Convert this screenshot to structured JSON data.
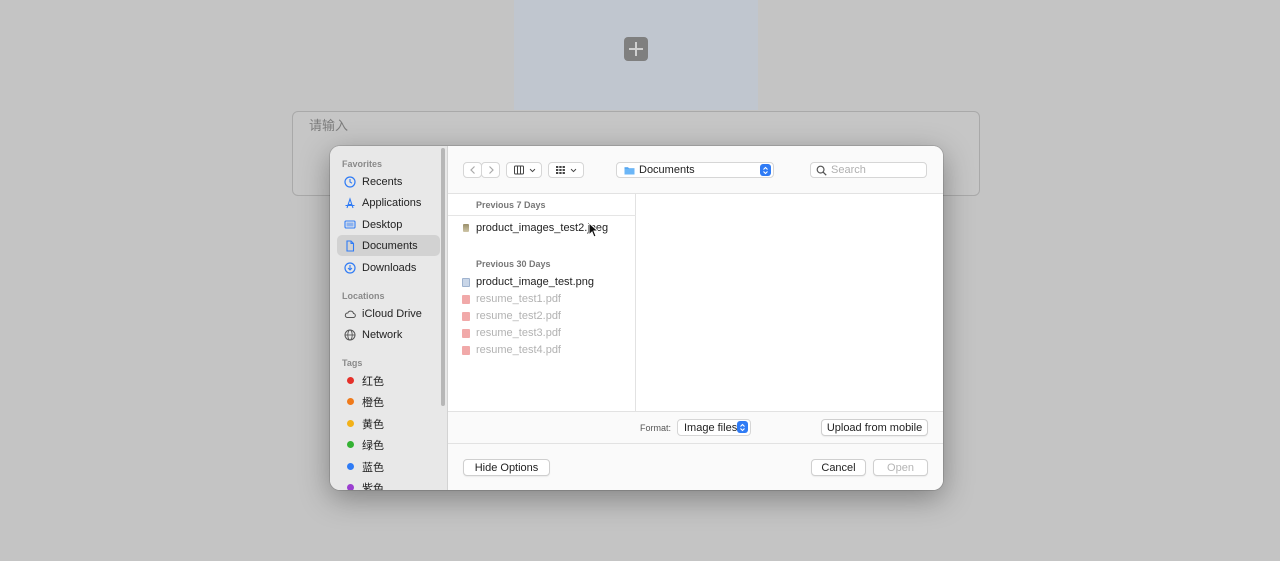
{
  "background": {
    "input_placeholder": "请输入"
  },
  "sidebar": {
    "favorites_header": "Favorites",
    "favorites": [
      {
        "label": "Recents",
        "icon": "clock-icon"
      },
      {
        "label": "Applications",
        "icon": "applications-icon"
      },
      {
        "label": "Desktop",
        "icon": "desktop-icon"
      },
      {
        "label": "Documents",
        "icon": "document-icon",
        "selected": true
      },
      {
        "label": "Downloads",
        "icon": "download-icon"
      }
    ],
    "locations_header": "Locations",
    "locations": [
      {
        "label": "iCloud Drive",
        "icon": "cloud-icon"
      },
      {
        "label": "Network",
        "icon": "globe-icon"
      }
    ],
    "tags_header": "Tags",
    "tags": [
      {
        "label": "红色",
        "color": "#e5312a"
      },
      {
        "label": "橙色",
        "color": "#f07a1a"
      },
      {
        "label": "黄色",
        "color": "#f2b118"
      },
      {
        "label": "绿色",
        "color": "#34b233"
      },
      {
        "label": "蓝色",
        "color": "#2f7bf5"
      },
      {
        "label": "紫色",
        "color": "#9b3fd0"
      }
    ]
  },
  "toolbar": {
    "location": "Documents",
    "search_placeholder": "Search"
  },
  "files": {
    "group1_header": "Previous 7 Days",
    "group1": [
      {
        "name": "product_images_test2.jpeg",
        "enabled": true
      }
    ],
    "group2_header": "Previous 30 Days",
    "group2": [
      {
        "name": "product_image_test.png",
        "enabled": true
      },
      {
        "name": "resume_test1.pdf",
        "enabled": false
      },
      {
        "name": "resume_test2.pdf",
        "enabled": false
      },
      {
        "name": "resume_test3.pdf",
        "enabled": false
      },
      {
        "name": "resume_test4.pdf",
        "enabled": false
      }
    ]
  },
  "format": {
    "label": "Format:",
    "value": "Image files"
  },
  "buttons": {
    "upload_mobile": "Upload from mobile",
    "hide_options": "Hide Options",
    "cancel": "Cancel",
    "open": "Open"
  },
  "colors": {
    "accent": "#2f7bf5",
    "pdf_icon": "#f1a9a9"
  }
}
